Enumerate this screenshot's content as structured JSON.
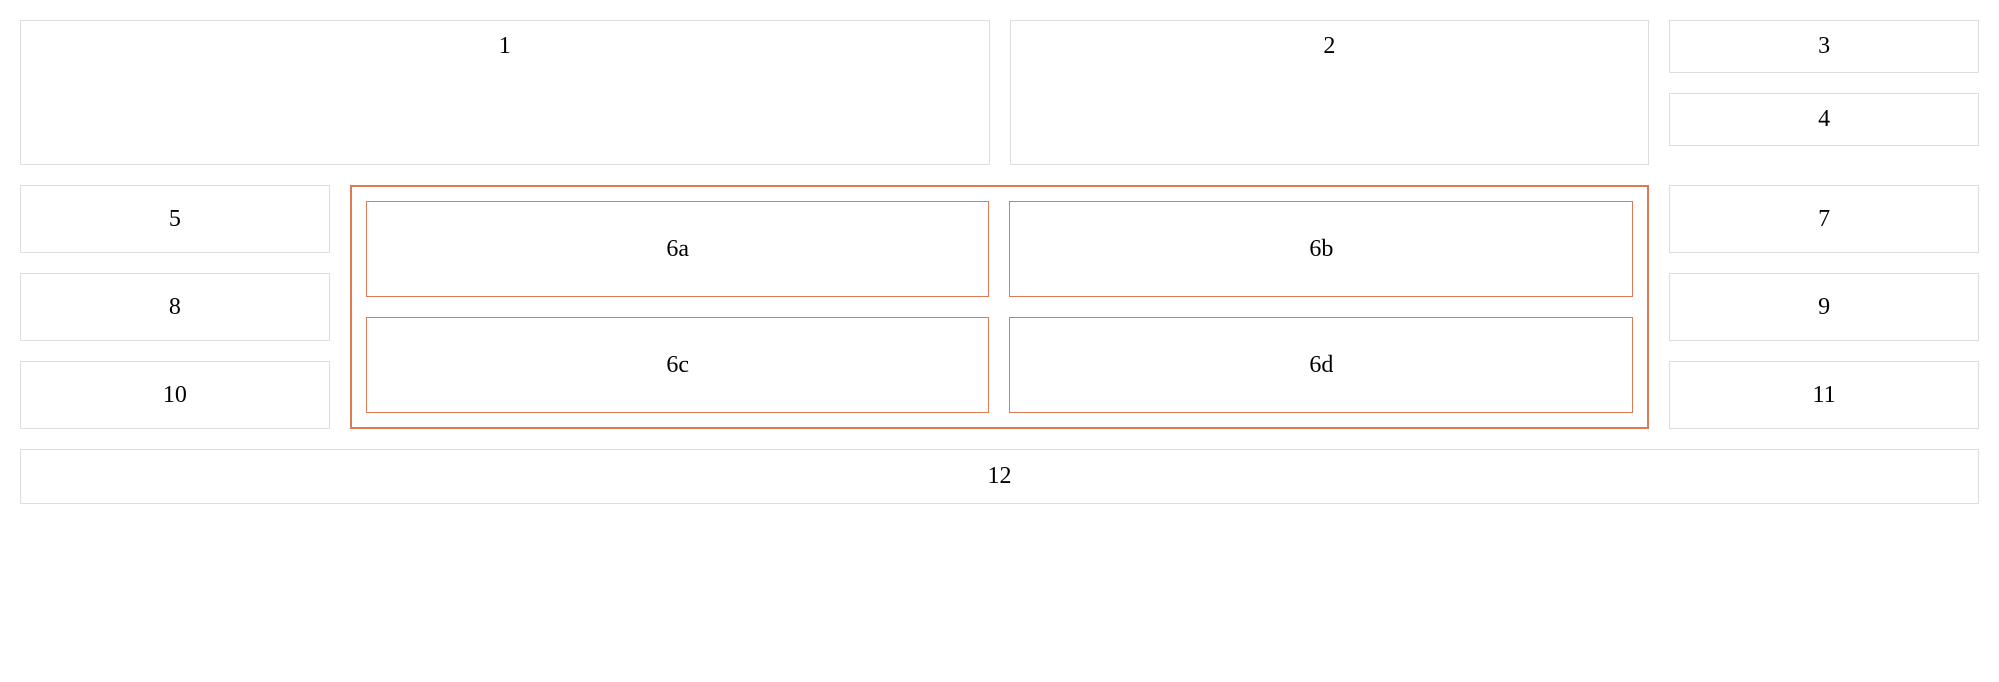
{
  "grid": {
    "box1": "1",
    "box2": "2",
    "box3": "3",
    "box4": "4",
    "box5": "5",
    "box6a": "6a",
    "box6b": "6b",
    "box6c": "6c",
    "box6d": "6d",
    "box7": "7",
    "box8": "8",
    "box9": "9",
    "box10": "10",
    "box11": "11",
    "box12": "12"
  },
  "colors": {
    "default_border": "#dddddd",
    "highlight_border": "#e07856"
  }
}
